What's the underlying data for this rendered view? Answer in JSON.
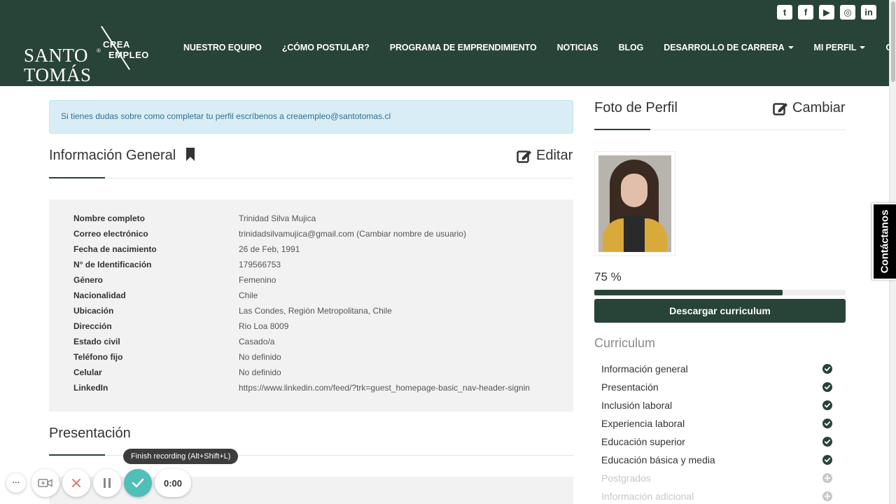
{
  "header": {
    "logo": {
      "line1": "SANTO",
      "line2": "TOMÁS",
      "reg": "®",
      "crea": "CREA",
      "empleo": "EMPLEO"
    },
    "social": [
      {
        "icon": "twitter-icon",
        "glyph": "t"
      },
      {
        "icon": "facebook-icon",
        "glyph": "f"
      },
      {
        "icon": "youtube-icon",
        "glyph": "▶"
      },
      {
        "icon": "instagram-icon",
        "glyph": "◎"
      },
      {
        "icon": "linkedin-icon",
        "glyph": "in"
      }
    ],
    "nav": [
      {
        "label": "NUESTRO EQUIPO",
        "dropdown": false
      },
      {
        "label": "¿CÓMO POSTULAR?",
        "dropdown": false
      },
      {
        "label": "PROGRAMA DE EMPRENDIMIENTO",
        "dropdown": false
      },
      {
        "label": "NOTICIAS",
        "dropdown": false
      },
      {
        "label": "BLOG",
        "dropdown": false
      },
      {
        "label": "DESARROLLO DE CARRERA",
        "dropdown": true
      },
      {
        "label": "MI PERFIL",
        "dropdown": true
      },
      {
        "label": "CUENTA",
        "dropdown": true
      }
    ]
  },
  "alert": {
    "text": "Si tienes dudas sobre como completar tu perfil escríbenos a",
    "email": "creaempleo@santotomas.cl"
  },
  "general": {
    "title": "Información General",
    "edit_label": "Editar",
    "rows": [
      {
        "label": "Nombre completo",
        "value": "Trinidad Silva Mujica"
      },
      {
        "label": "Correo electrónico",
        "value": "trinidadsilvamujica@gmail.com (Cambiar nombre de usuario)"
      },
      {
        "label": "Fecha de nacimiento",
        "value": "26 de Feb, 1991"
      },
      {
        "label": "N° de Identificación",
        "value": "179566753"
      },
      {
        "label": "Género",
        "value": "Femenino"
      },
      {
        "label": "Nacionalidad",
        "value": "Chile"
      },
      {
        "label": "Ubicación",
        "value": "Las Condes, Región Metropolitana, Chile"
      },
      {
        "label": "Dirección",
        "value": "Rio Loa 8009"
      },
      {
        "label": "Estado civil",
        "value": "Casado/a"
      },
      {
        "label": "Teléfono fijo",
        "value": "No definido"
      },
      {
        "label": "Celular",
        "value": "No definido"
      },
      {
        "label": "LinkedIn",
        "value": "https://www.linkedin.com/feed/?trk=guest_homepage-basic_nav-header-signin"
      }
    ]
  },
  "presentation": {
    "title": "Presentación"
  },
  "profile_photo": {
    "title": "Foto de Perfil",
    "change_label": "Cambiar"
  },
  "completion": {
    "percent_label": "75 %",
    "fraction": 0.75
  },
  "download_label": "Descargar curriculum",
  "curriculum": {
    "title": "Curriculum",
    "items": [
      {
        "label": "Información general",
        "done": true
      },
      {
        "label": "Presentación",
        "done": true
      },
      {
        "label": "Inclusión laboral",
        "done": true
      },
      {
        "label": "Experiencia laboral",
        "done": true
      },
      {
        "label": "Educación superior",
        "done": true
      },
      {
        "label": "Educación básica y media",
        "done": true
      },
      {
        "label": "Postgrados",
        "done": false
      },
      {
        "label": "Información adicional",
        "done": false
      }
    ]
  },
  "contact_tab": "Contáctanos",
  "recorder": {
    "tooltip": "Finish recording (Alt+Shift+L)",
    "timer": "0:00",
    "more_glyph": "···"
  },
  "colors": {
    "brand": "#284337",
    "done": "#284337",
    "todo": "#c8c8c8",
    "check_button": "#4fbfb8"
  }
}
